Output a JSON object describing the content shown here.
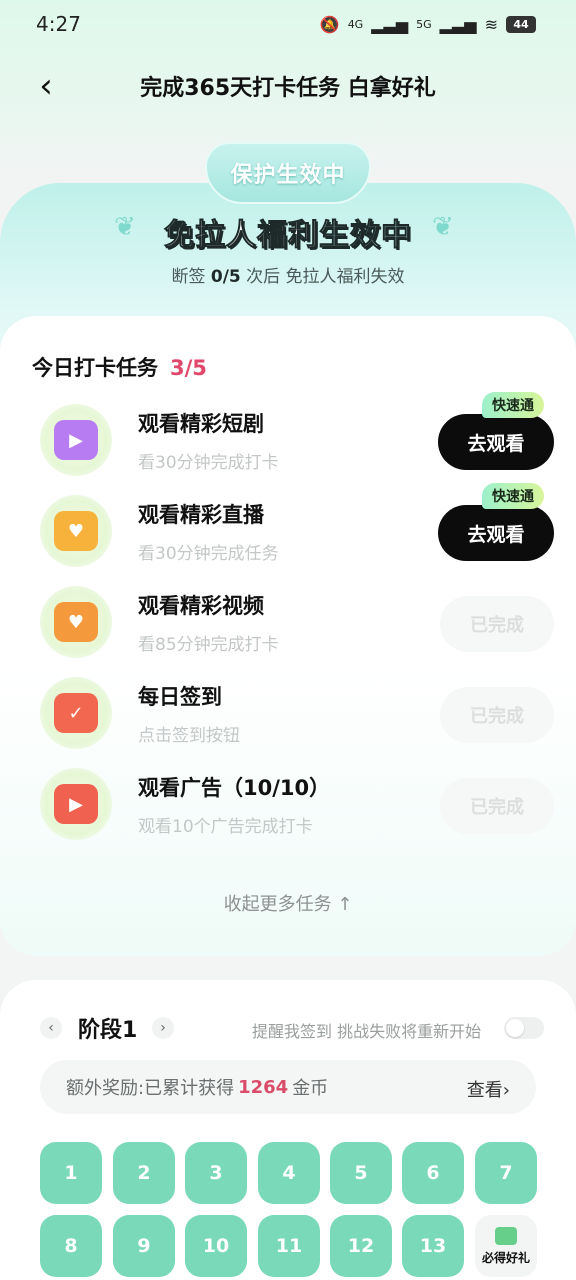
{
  "status_bar": {
    "time": "4:27",
    "battery": "44",
    "net1": "4G",
    "net2": "5G"
  },
  "nav": {
    "title": "完成365天打卡任务 白拿好礼",
    "back": "‹"
  },
  "banner": {
    "shield_text": "保护生效中",
    "title_part1": "免拉人福利",
    "title_part2": "生效中",
    "sub_prefix": "断签",
    "sub_count": "0/5",
    "sub_suffix": "次后 免拉人福利失效"
  },
  "tasks": {
    "title": "今日打卡任务",
    "count": "3/5",
    "items": [
      {
        "title": "观看精彩短剧",
        "desc": "看30分钟完成打卡",
        "button": "去观看",
        "tag": "快速通",
        "done": false,
        "icon": "tv-icon",
        "color": "#b77cf2"
      },
      {
        "title": "观看精彩直播",
        "desc": "看30分钟完成任务",
        "button": "去观看",
        "tag": "快速通",
        "done": false,
        "icon": "camera-icon",
        "color": "#f7b23b"
      },
      {
        "title": "观看精彩视频",
        "desc": "看85分钟完成打卡",
        "button": "已完成",
        "done": true,
        "icon": "video-icon",
        "color": "#f59a3c"
      },
      {
        "title": "每日签到",
        "desc": "点击签到按钮",
        "button": "已完成",
        "done": true,
        "icon": "calendar-icon",
        "color": "#f2674f"
      },
      {
        "title": "观看广告（10/10）",
        "desc": "观看10个广告完成打卡",
        "button": "已完成",
        "done": true,
        "icon": "ad-icon",
        "color": "#f0614f"
      }
    ],
    "collapse": "收起更多任务 ↑"
  },
  "stage": {
    "title": "阶段1",
    "prev": "‹",
    "next": "›",
    "hint": "提醒我签到 挑战失败将重新开始",
    "reward_prefix": "额外奖励:已累计获得",
    "reward_amount": "1264",
    "reward_suffix": "金币",
    "reward_link": "查看›",
    "days": [
      "1",
      "2",
      "3",
      "4",
      "5",
      "6",
      "7",
      "8",
      "9",
      "10",
      "11",
      "12",
      "13"
    ],
    "gift_label": "必得好礼"
  }
}
